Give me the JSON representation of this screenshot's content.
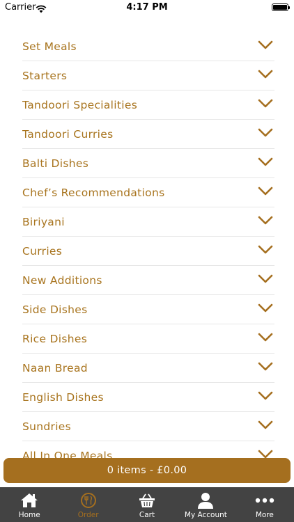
{
  "status_bar": {
    "carrier": "Carrier",
    "time": "4:17 PM"
  },
  "menu": {
    "categories": [
      "Set Meals",
      "Starters",
      "Tandoori Specialities",
      "Tandoori Curries",
      "Balti Dishes",
      "Chef’s Recommendations",
      "Biriyani",
      "Curries",
      "New Additions",
      "Side Dishes",
      "Rice Dishes",
      "Naan Bread",
      "English Dishes",
      "Sundries",
      "All In One Meals"
    ]
  },
  "cart": {
    "summary": "0 items - £0.00"
  },
  "tab_bar": {
    "tabs": [
      {
        "label": "Home",
        "icon": "home-icon",
        "active": false
      },
      {
        "label": "Order",
        "icon": "order-icon",
        "active": true
      },
      {
        "label": "Cart",
        "icon": "basket-icon",
        "active": false
      },
      {
        "label": "My Account",
        "icon": "user-icon",
        "active": false
      },
      {
        "label": "More",
        "icon": "more-icon",
        "active": false
      }
    ]
  },
  "colors": {
    "accent": "#a56f1f",
    "tab_bar_bg": "#434343",
    "divider": "#e6e6e6"
  }
}
